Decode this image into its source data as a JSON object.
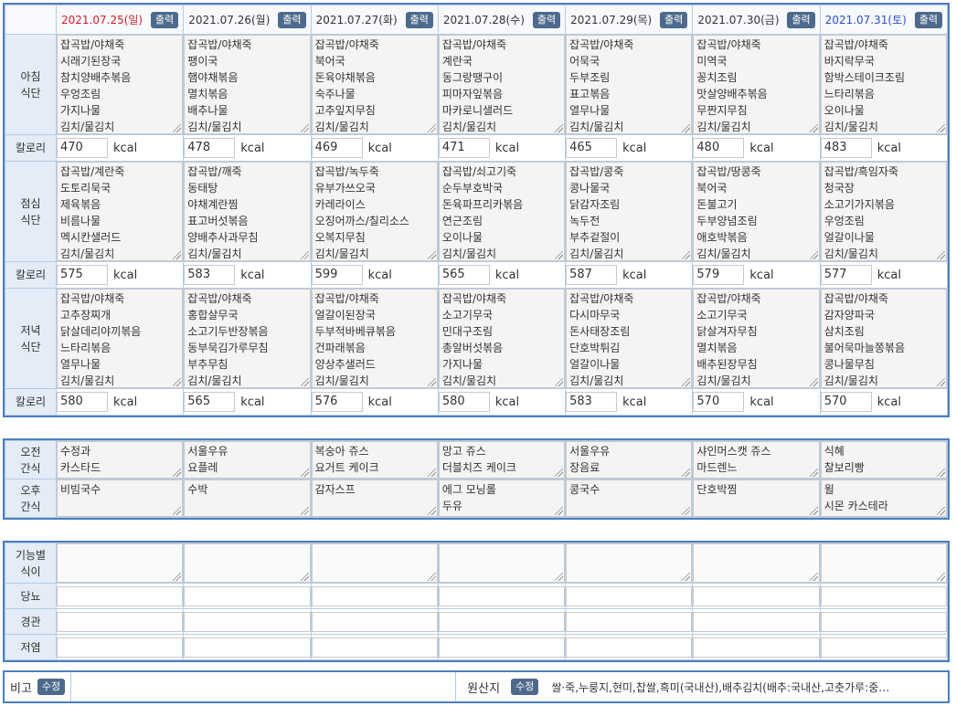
{
  "buttons": {
    "print": "출력",
    "edit": "수정"
  },
  "labels": {
    "breakfast": [
      "아침",
      "식단"
    ],
    "lunch": [
      "점심",
      "식단"
    ],
    "dinner": [
      "저녁",
      "식단"
    ],
    "calorie": "칼로리",
    "am_snack": [
      "오전",
      "간식"
    ],
    "pm_snack": [
      "오후",
      "간식"
    ],
    "functional": [
      "기능별",
      "식이"
    ],
    "sugar": "당뇨",
    "tube": "경관",
    "lowsalt": "저염",
    "note": "비고",
    "origin": "원산지"
  },
  "unit": "kcal",
  "days": [
    {
      "date": "2021.07.25(일)",
      "breakfast": [
        "잡곡밥/야채죽",
        "시래기된장국",
        "참치양배추볶음",
        "우엉조림",
        "가지나물",
        "김치/물김치"
      ],
      "breakfast_kcal": "470",
      "lunch": [
        "잡곡밥/계란죽",
        "도토리묵국",
        "제육볶음",
        "비름나물",
        "멕시칸샐러드",
        "김치/물김치"
      ],
      "lunch_kcal": "575",
      "dinner": [
        "잡곡밥/야채죽",
        "고추장찌개",
        "닭살데리야끼볶음",
        "느타리볶음",
        "열무나물",
        "김치/물김치"
      ],
      "dinner_kcal": "580",
      "am_snack": [
        "수정과",
        "카스타드"
      ],
      "pm_snack": [
        "비빔국수"
      ]
    },
    {
      "date": "2021.07.26(월)",
      "breakfast": [
        "잡곡밥/야채죽",
        "팽이국",
        "햄야채볶음",
        "멸치볶음",
        "배추나물",
        "김치/물김치"
      ],
      "breakfast_kcal": "478",
      "lunch": [
        "잡곡밥/깨죽",
        "동태탕",
        "야채계란찜",
        "표고버섯볶음",
        "양배추사과무침",
        "김치/물김치"
      ],
      "lunch_kcal": "583",
      "dinner": [
        "잡곡밥/야채죽",
        "홍합살무국",
        "소고기두반장볶음",
        "동부묵김가루무침",
        "부추무침",
        "김치/물김치"
      ],
      "dinner_kcal": "565",
      "am_snack": [
        "서울우유",
        "요플레"
      ],
      "pm_snack": [
        "수박"
      ]
    },
    {
      "date": "2021.07.27(화)",
      "breakfast": [
        "잡곡밥/야채죽",
        "북어국",
        "돈육야채볶음",
        "숙주나물",
        "고추잎지무침",
        "김치/물김치"
      ],
      "breakfast_kcal": "469",
      "lunch": [
        "잡곡밥/녹두죽",
        "유부가쓰오국",
        "카레라이스",
        "오징어까스/칠리소스",
        "오복지무침",
        "김치/물김치"
      ],
      "lunch_kcal": "599",
      "dinner": [
        "잡곡밥/야채죽",
        "얼갈이된장국",
        "두부적바베큐볶음",
        "건파래볶음",
        "양상추샐러드",
        "김치/물김치"
      ],
      "dinner_kcal": "576",
      "am_snack": [
        "복숭아 쥬스",
        "요거트 케이크"
      ],
      "pm_snack": [
        "감자스프"
      ]
    },
    {
      "date": "2021.07.28(수)",
      "breakfast": [
        "잡곡밥/야채죽",
        "계란국",
        "동그랑땡구이",
        "피마자잎볶음",
        "마카로니샐러드",
        "김치/물김치"
      ],
      "breakfast_kcal": "471",
      "lunch": [
        "잡곡밥/쇠고기죽",
        "순두부호박국",
        "돈육파프리카볶음",
        "연근조림",
        "오이나물",
        "김치/물김치"
      ],
      "lunch_kcal": "565",
      "dinner": [
        "잡곡밥/야채죽",
        "소고기무국",
        "민대구조림",
        "총알버섯볶음",
        "가지나물",
        "김치/물김치"
      ],
      "dinner_kcal": "580",
      "am_snack": [
        "망고 쥬스",
        "더블치즈 케이크"
      ],
      "pm_snack": [
        "에그 모닝롤",
        "두유"
      ]
    },
    {
      "date": "2021.07.29(목)",
      "breakfast": [
        "잡곡밥/야채죽",
        "어묵국",
        "두부조림",
        "표고볶음",
        "열무나물",
        "김치/물김치"
      ],
      "breakfast_kcal": "465",
      "lunch": [
        "잡곡밥/콩죽",
        "콩나물국",
        "닭감자조림",
        "녹두전",
        "부추겉절이",
        "김치/물김치"
      ],
      "lunch_kcal": "587",
      "dinner": [
        "잡곡밥/야채죽",
        "다시마무국",
        "돈사태장조림",
        "단호박튀김",
        "얼갈이나물",
        "김치/물김치"
      ],
      "dinner_kcal": "583",
      "am_snack": [
        "서울우유",
        "장음료"
      ],
      "pm_snack": [
        "콩국수"
      ]
    },
    {
      "date": "2021.07.30(금)",
      "breakfast": [
        "잡곡밥/야채죽",
        "미역국",
        "꽁치조림",
        "맛살양배추볶음",
        "무짠지무침",
        "김치/물김치"
      ],
      "breakfast_kcal": "480",
      "lunch": [
        "잡곡밥/땅콩죽",
        "북어국",
        "돈불고기",
        "두부양념조림",
        "애호박볶음",
        "김치/물김치"
      ],
      "lunch_kcal": "579",
      "dinner": [
        "잡곡밥/야채죽",
        "소고기무국",
        "닭살겨자무침",
        "멸치볶음",
        "배추된장무침",
        "김치/물김치"
      ],
      "dinner_kcal": "570",
      "am_snack": [
        "샤인머스캣 쥬스",
        "마드렌느"
      ],
      "pm_snack": [
        "단호박찜"
      ]
    },
    {
      "date": "2021.07.31(토)",
      "breakfast": [
        "잡곡밥/야채죽",
        "바지락무국",
        "함박스테이크조림",
        "느타리볶음",
        "오이나물",
        "김치/물김치"
      ],
      "breakfast_kcal": "483",
      "lunch": [
        "잡곡밥/흑임자죽",
        "청국장",
        "소고기가지볶음",
        "우엉조림",
        "얼갈이나물",
        "김치/물김치"
      ],
      "lunch_kcal": "577",
      "dinner": [
        "잡곡밥/야채죽",
        "감자양파국",
        "삼치조림",
        "불어묵마늘쫑볶음",
        "콩나물무침",
        "김치/물김치"
      ],
      "dinner_kcal": "570",
      "am_snack": [
        "식혜",
        "찰보리빵"
      ],
      "pm_snack": [
        "윌",
        "시몬 카스테라"
      ]
    }
  ],
  "note_text": "",
  "origin_text": "쌀·죽,누룽지,현미,찹쌀,흑미(국내산),배추김치(배추:국내산,고춧가루:중…"
}
